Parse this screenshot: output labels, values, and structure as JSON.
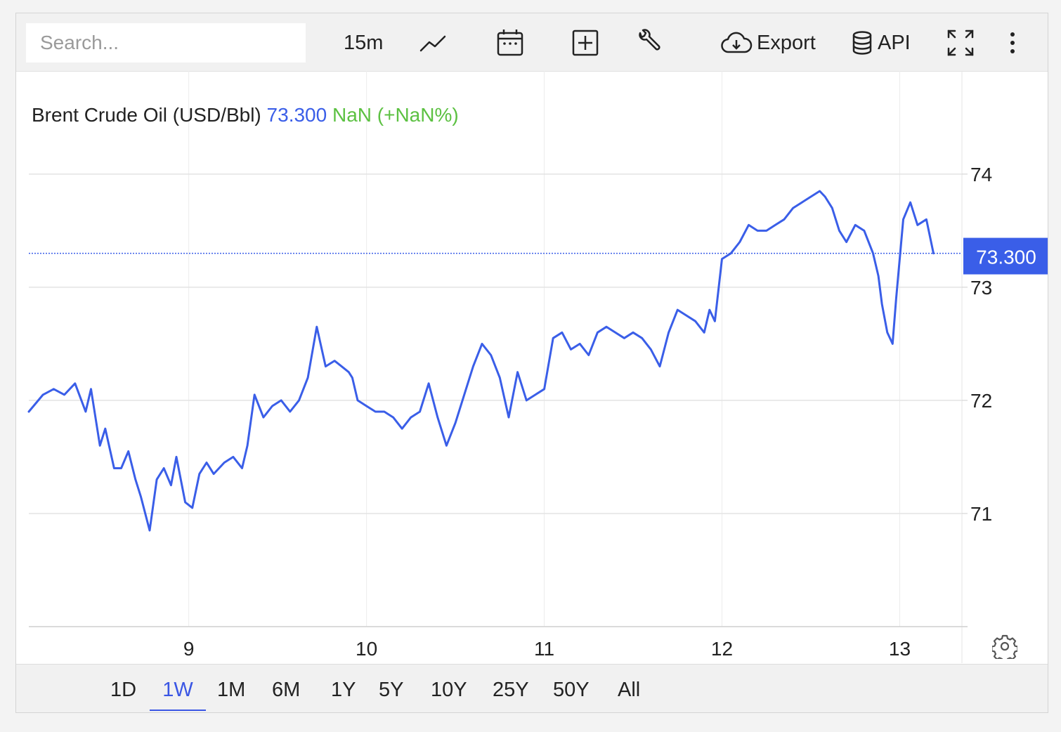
{
  "toolbar": {
    "search_placeholder": "Search...",
    "interval": "15m",
    "chart_type_icon": "line-chart-icon",
    "calendar_icon": "calendar-icon",
    "compare_icon": "plus-square-icon",
    "tools_icon": "wrench-icon",
    "export_label": "Export",
    "api_label": "API",
    "fullscreen_icon": "expand-icon",
    "more_icon": "more-vertical-icon"
  },
  "legend": {
    "title": "Brent Crude Oil (USD/Bbl)",
    "price": "73.300",
    "change": "NaN (+NaN%)"
  },
  "price_label": "73.300",
  "settings_icon": "gear-icon",
  "ranges": {
    "items": [
      "1D",
      "1W",
      "1M",
      "6M",
      "1Y",
      "5Y",
      "10Y",
      "25Y",
      "50Y",
      "All"
    ],
    "active": "1W"
  },
  "colors": {
    "line": "#3a5ee8",
    "change_positive": "#5cc142",
    "accent": "#3a5ee8",
    "price_label_bg": "#3a5ee8"
  },
  "chart_data": {
    "type": "line",
    "title": "Brent Crude Oil (USD/Bbl)",
    "xlabel": "",
    "ylabel": "",
    "x_ticks": [
      "9",
      "10",
      "11",
      "12",
      "13"
    ],
    "y_ticks": [
      71,
      72,
      73,
      74
    ],
    "ylim": [
      70,
      74.8
    ],
    "xlim": [
      8.1,
      13.35
    ],
    "last_value": 73.3,
    "grid": true,
    "series": [
      {
        "name": "Brent Crude Oil (USD/Bbl)",
        "x": [
          8.1,
          8.18,
          8.24,
          8.3,
          8.36,
          8.42,
          8.45,
          8.5,
          8.53,
          8.58,
          8.62,
          8.66,
          8.7,
          8.73,
          8.78,
          8.82,
          8.86,
          8.9,
          8.93,
          8.98,
          9.02,
          9.06,
          9.1,
          9.14,
          9.2,
          9.25,
          9.3,
          9.33,
          9.37,
          9.42,
          9.47,
          9.52,
          9.57,
          9.62,
          9.67,
          9.72,
          9.77,
          9.82,
          9.86,
          9.9,
          9.92,
          9.95,
          10.0,
          10.05,
          10.1,
          10.15,
          10.2,
          10.25,
          10.3,
          10.35,
          10.4,
          10.45,
          10.5,
          10.55,
          10.6,
          10.65,
          10.7,
          10.75,
          10.8,
          10.85,
          10.9,
          10.95,
          11.0,
          11.05,
          11.1,
          11.15,
          11.2,
          11.25,
          11.3,
          11.35,
          11.4,
          11.45,
          11.5,
          11.55,
          11.6,
          11.65,
          11.7,
          11.75,
          11.8,
          11.85,
          11.9,
          11.93,
          11.96,
          12.0,
          12.05,
          12.1,
          12.15,
          12.2,
          12.25,
          12.3,
          12.35,
          12.4,
          12.45,
          12.5,
          12.55,
          12.58,
          12.62,
          12.66,
          12.7,
          12.75,
          12.8,
          12.85,
          12.88,
          12.9,
          12.93,
          12.96,
          12.98,
          13.02,
          13.06,
          13.1,
          13.15,
          13.19
        ],
        "values": [
          71.9,
          72.05,
          72.1,
          72.05,
          72.15,
          71.9,
          72.1,
          71.6,
          71.75,
          71.4,
          71.4,
          71.55,
          71.3,
          71.15,
          70.85,
          71.3,
          71.4,
          71.25,
          71.5,
          71.1,
          71.05,
          71.35,
          71.45,
          71.35,
          71.45,
          71.5,
          71.4,
          71.6,
          72.05,
          71.85,
          71.95,
          72.0,
          71.9,
          72.0,
          72.2,
          72.65,
          72.3,
          72.35,
          72.3,
          72.25,
          72.2,
          72.0,
          71.95,
          71.9,
          71.9,
          71.85,
          71.75,
          71.85,
          71.9,
          72.15,
          71.85,
          71.6,
          71.8,
          72.05,
          72.3,
          72.5,
          72.4,
          72.2,
          71.85,
          72.25,
          72.0,
          72.05,
          72.1,
          72.55,
          72.6,
          72.45,
          72.5,
          72.4,
          72.6,
          72.65,
          72.6,
          72.55,
          72.6,
          72.55,
          72.45,
          72.3,
          72.6,
          72.8,
          72.75,
          72.7,
          72.6,
          72.8,
          72.7,
          73.25,
          73.3,
          73.4,
          73.55,
          73.5,
          73.5,
          73.55,
          73.6,
          73.7,
          73.75,
          73.8,
          73.85,
          73.8,
          73.7,
          73.5,
          73.4,
          73.55,
          73.5,
          73.3,
          73.1,
          72.85,
          72.6,
          72.5,
          72.9,
          73.6,
          73.75,
          73.55,
          73.6,
          73.3
        ]
      }
    ]
  }
}
